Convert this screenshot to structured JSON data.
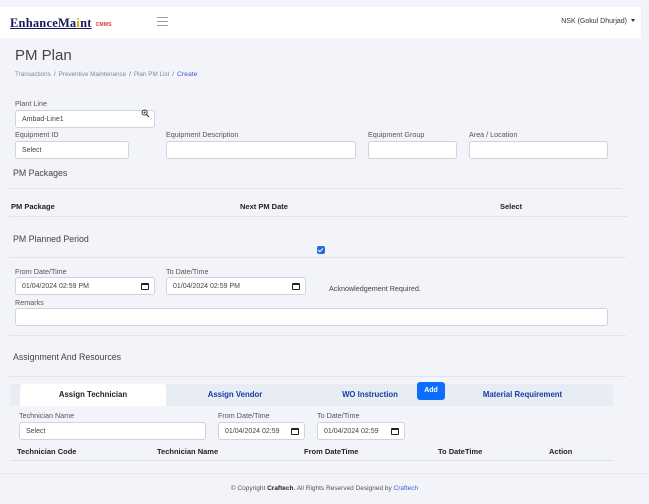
{
  "brand": {
    "name_a": "EnhanceMa",
    "name_hl": "i",
    "name_b": "nt",
    "sub": "CMMS"
  },
  "user": {
    "label": "NSK  (Gokul Dhurjad)"
  },
  "page": {
    "title": "PM Plan"
  },
  "breadcrumb": {
    "items": [
      "Transactions",
      "Preventive Maintenance",
      "Plan PM List"
    ],
    "active": "Create"
  },
  "form": {
    "plant_line": {
      "label": "Plant Line",
      "value": "Ambad-Line1"
    },
    "equipment_id": {
      "label": "Equipment ID",
      "value": "Select"
    },
    "equipment_description": {
      "label": "Equipment Description",
      "value": ""
    },
    "equipment_group": {
      "label": "Equipment Group",
      "value": ""
    },
    "area_location": {
      "label": "Area / Location",
      "value": ""
    }
  },
  "pm_packages": {
    "title": "PM Packages",
    "columns": [
      "PM Package",
      "Next PM Date",
      "Select"
    ]
  },
  "planned_period": {
    "title": "PM Planned Period",
    "from": {
      "label": "From Date/Time",
      "value": "01/04/2024 02:59 PM"
    },
    "to": {
      "label": "To Date/Time",
      "value": "01/04/2024 02:59 PM"
    },
    "ack": {
      "label": "Acknowledgement Required.",
      "checked": true
    },
    "remarks": {
      "label": "Remarks",
      "value": ""
    }
  },
  "assignment": {
    "title": "Assignment And Resources",
    "tabs": [
      "Assign Technician",
      "Assign Vendor",
      "WO Instruction",
      "Material Requirement"
    ],
    "active_tab": 0,
    "technician": {
      "label": "Technician Name",
      "value": "Select"
    },
    "from": {
      "label": "From Date/Time",
      "value": "01/04/2024 02:59"
    },
    "to": {
      "label": "To Date/Time",
      "value": "01/04/2024 02:59"
    },
    "add_label": "Add",
    "columns": [
      "Technician Code",
      "Technician Name",
      "From DateTime",
      "To DateTime",
      "Action"
    ]
  },
  "footer": {
    "prefix": "© Copyright",
    "company": "Craftech",
    "middle": ". All Rights Reserved Designed by",
    "designer": "Craftech"
  },
  "colors": {
    "primary": "#0d6efd",
    "link": "#1a3aa8",
    "brand_accent": "#d4a017"
  }
}
